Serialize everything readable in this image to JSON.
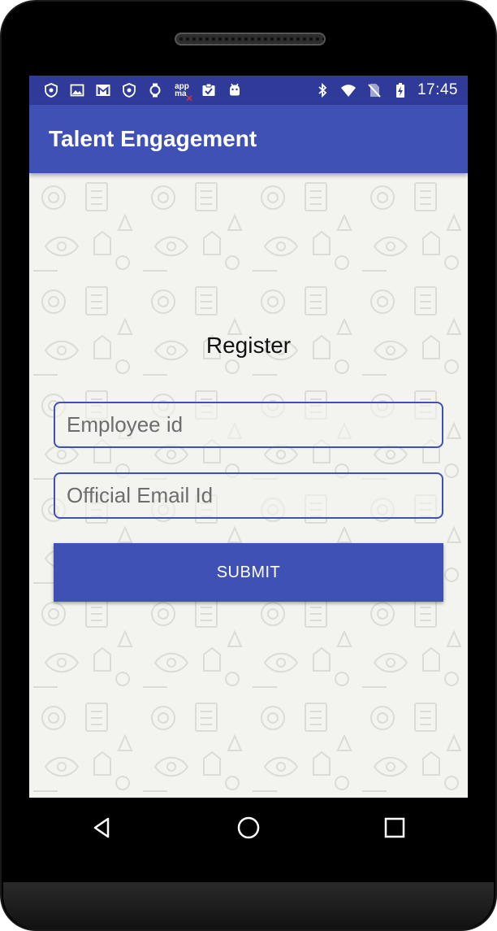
{
  "status_bar": {
    "time": "17:45",
    "left_icons": [
      "shield-icon",
      "image-icon",
      "gmail-icon",
      "shield-icon",
      "watch-icon",
      "appmax-icon",
      "clipboard-check-icon",
      "android-icon"
    ],
    "right_icons": [
      "bluetooth-icon",
      "wifi-icon",
      "no-sim-icon",
      "battery-charging-icon"
    ],
    "appmax_label_top": "app",
    "appmax_label_bottom": "ma",
    "background_color": "#2f3a99"
  },
  "app_bar": {
    "title": "Talent Engagement",
    "color": "#3f51b5"
  },
  "form": {
    "title": "Register",
    "employee_id": {
      "value": "",
      "placeholder": "Employee id"
    },
    "email": {
      "value": "",
      "placeholder": "Official Email Id"
    },
    "submit_label": "SUBMIT",
    "accent_color": "#3f51b5"
  },
  "nav_bar": {
    "icons": [
      "back-icon",
      "home-icon",
      "recents-icon"
    ]
  }
}
